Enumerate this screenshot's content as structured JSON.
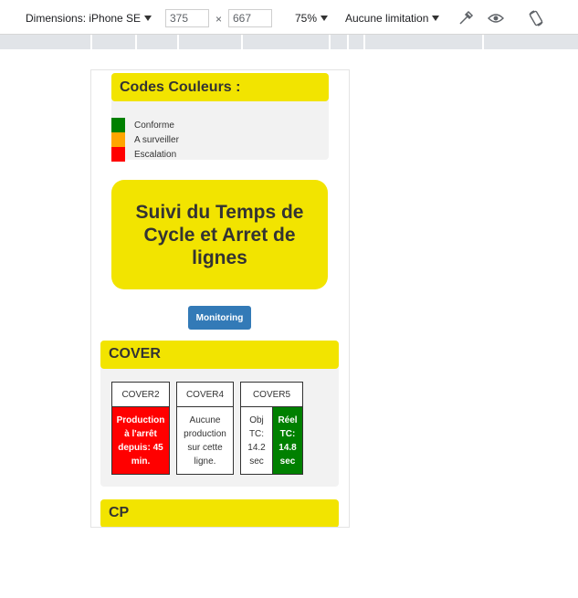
{
  "toolbar": {
    "dimensions_label": "Dimensions: iPhone SE",
    "width": "375",
    "times": "×",
    "height": "667",
    "zoom": "75%",
    "throttle": "Aucune limitation"
  },
  "legend": {
    "title": "Codes Couleurs :",
    "items": [
      {
        "label": "Conforme",
        "color": "#008000"
      },
      {
        "label": "A surveiller",
        "color": "#ffa500"
      },
      {
        "label": "Escalation",
        "color": "#ff0000"
      }
    ]
  },
  "hero": {
    "title": "Suivi du Temps de Cycle et Arret de lignes"
  },
  "monitoring_button": "Monitoring",
  "sections": [
    {
      "title": "COVER",
      "machines": [
        {
          "name": "COVER2",
          "cells": [
            {
              "text": "Production à l'arrêt depuis: 45 min.",
              "status": "red"
            }
          ]
        },
        {
          "name": "COVER4",
          "cells": [
            {
              "text": "Aucune production sur cette ligne.",
              "status": "white"
            }
          ]
        },
        {
          "name": "COVER5",
          "cells": [
            {
              "text": "Obj TC: 14.2 sec",
              "status": "white"
            },
            {
              "text": "Réel TC: 14.8 sec",
              "status": "green"
            }
          ]
        }
      ]
    },
    {
      "title": "CP"
    }
  ]
}
